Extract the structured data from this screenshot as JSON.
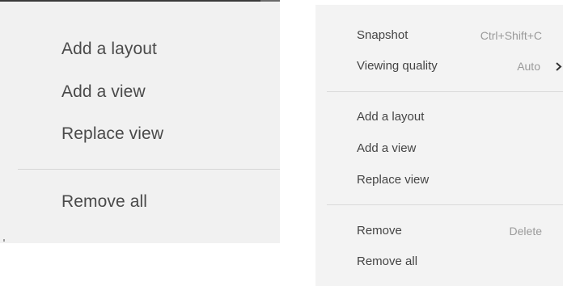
{
  "left_menu": {
    "items": [
      {
        "label": "Add a layout"
      },
      {
        "label": "Add a view"
      },
      {
        "label": "Replace view"
      },
      {
        "label": "Remove all"
      }
    ]
  },
  "right_menu": {
    "snapshot": {
      "label": "Snapshot",
      "shortcut": "Ctrl+Shift+C"
    },
    "viewing_quality": {
      "label": "Viewing quality",
      "value": "Auto",
      "icon": "chevron-right-icon"
    },
    "add_layout": {
      "label": "Add a layout"
    },
    "add_view": {
      "label": "Add a view"
    },
    "replace_view": {
      "label": "Replace view"
    },
    "remove": {
      "label": "Remove",
      "shortcut": "Delete"
    },
    "remove_all": {
      "label": "Remove all"
    }
  },
  "colors": {
    "menu_bg_left": "#f1f1f1",
    "menu_bg_right": "#f3f3f3",
    "text": "#444444",
    "muted_text": "#9a9a9a",
    "divider": "#d6d6d6"
  }
}
